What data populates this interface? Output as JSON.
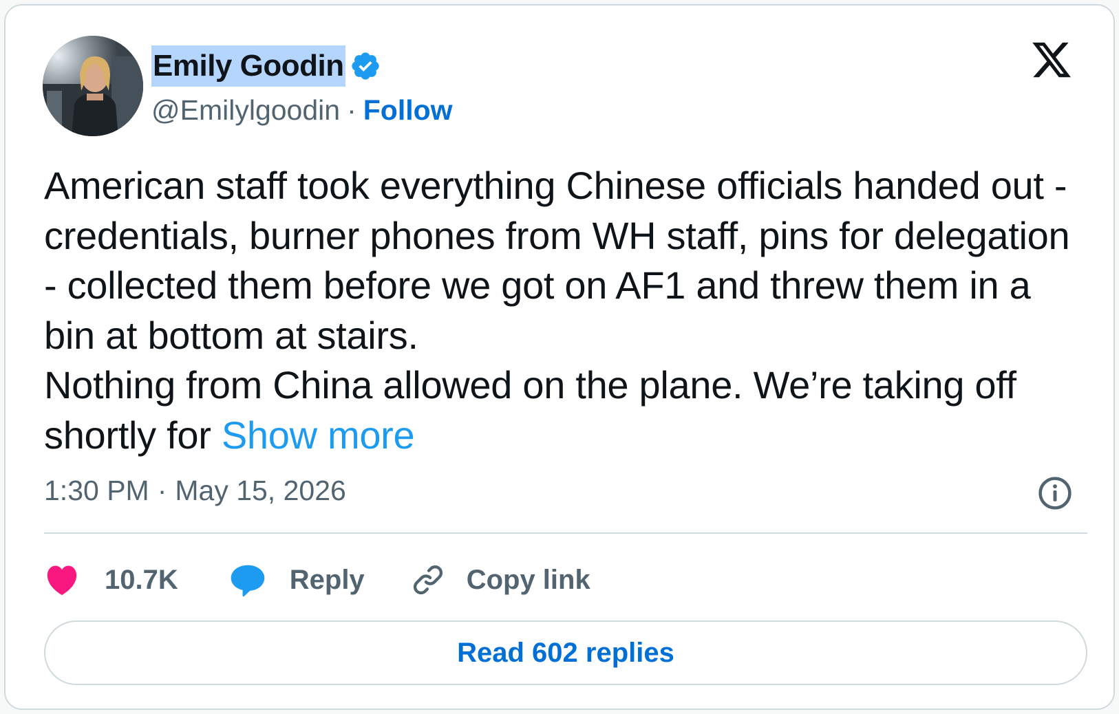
{
  "author": {
    "display_name": "Emily Goodin",
    "handle": "@Emilylgoodin",
    "separator": "·",
    "follow_label": "Follow",
    "verified": true,
    "verified_color": "#1d9bf0"
  },
  "tweet": {
    "paragraphs": [
      "American staff took everything Chinese officials handed out - credentials, burner phones from WH staff, pins for delegation - collected them before we got on AF1 and threw them in a bin at bottom at stairs."
    ],
    "last_paragraph": "Nothing from China allowed on the plane. We’re taking off shortly for",
    "show_more_label": "Show more",
    "time": "1:30 PM",
    "date_separator": "·",
    "date": "May 15, 2026"
  },
  "actions": {
    "likes_count": "10.7K",
    "reply_label": "Reply",
    "copy_link_label": "Copy link"
  },
  "read_replies_label": "Read 602 replies",
  "icons": {
    "platform_logo": "x-logo-icon",
    "info": "info-icon",
    "like": "heart-icon",
    "reply": "speech-bubble-icon",
    "copy": "link-icon",
    "verified": "verified-badge-icon"
  },
  "colors": {
    "like": "#f91880",
    "reply": "#1d9bf0",
    "link_text": "#006fd6",
    "secondary_text": "#536471"
  }
}
